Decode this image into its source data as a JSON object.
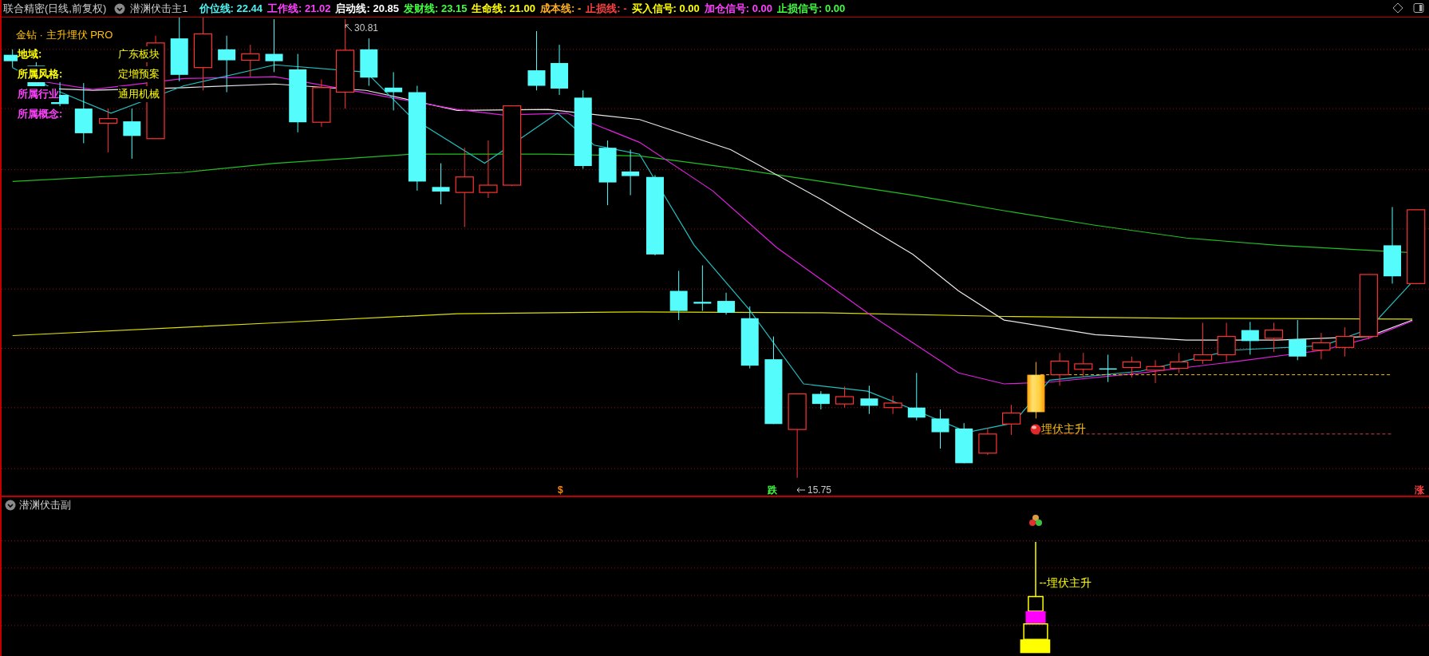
{
  "header": {
    "title": "联合精密(日线,前复权)",
    "indicator": "潜渊伏击主1",
    "lines": [
      {
        "label": "价位线:",
        "value": "22.44",
        "color": "#4ff0f0"
      },
      {
        "label": "工作线:",
        "value": "21.02",
        "color": "#ff40ff"
      },
      {
        "label": "启动线:",
        "value": "20.85",
        "color": "#ffffff"
      },
      {
        "label": "发财线:",
        "value": "23.15",
        "color": "#40ff40"
      },
      {
        "label": "生命线:",
        "value": "21.00",
        "color": "#ffff00"
      },
      {
        "label": "成本线:",
        "value": "-",
        "color": "#ffb020"
      },
      {
        "label": "止损线:",
        "value": "-",
        "color": "#ff4040"
      },
      {
        "label": "买入信号:",
        "value": "0.00",
        "color": "#ffff00"
      },
      {
        "label": "加仓信号:",
        "value": "0.00",
        "color": "#ff40ff"
      },
      {
        "label": "止损信号:",
        "value": "0.00",
        "color": "#40ff40"
      }
    ]
  },
  "info_panel": {
    "title": "金钻 · 主升埋伏 PRO",
    "rows": [
      {
        "label": "地域:",
        "value": "广东板块",
        "color": "#ffff00"
      },
      {
        "label": "所属风格:",
        "value": "定增预案",
        "color": "#ffff00"
      },
      {
        "label": "所属行业",
        "value": "通用机械",
        "color": "#ff40ff"
      },
      {
        "label": "所属概念:",
        "color": "#ff40ff"
      }
    ]
  },
  "main_chart": {
    "high_label": "30.81",
    "low_label": "15.75",
    "signal_label": "埋伏主升"
  },
  "markers": [
    {
      "text": "$",
      "color": "#ff8800"
    },
    {
      "text": "跌",
      "color": "#40ff40"
    },
    {
      "text": "涨",
      "color": "#ff4040"
    }
  ],
  "sub_chart": {
    "title": "潜渊伏击副",
    "signal_label": "--埋伏主升"
  }
}
